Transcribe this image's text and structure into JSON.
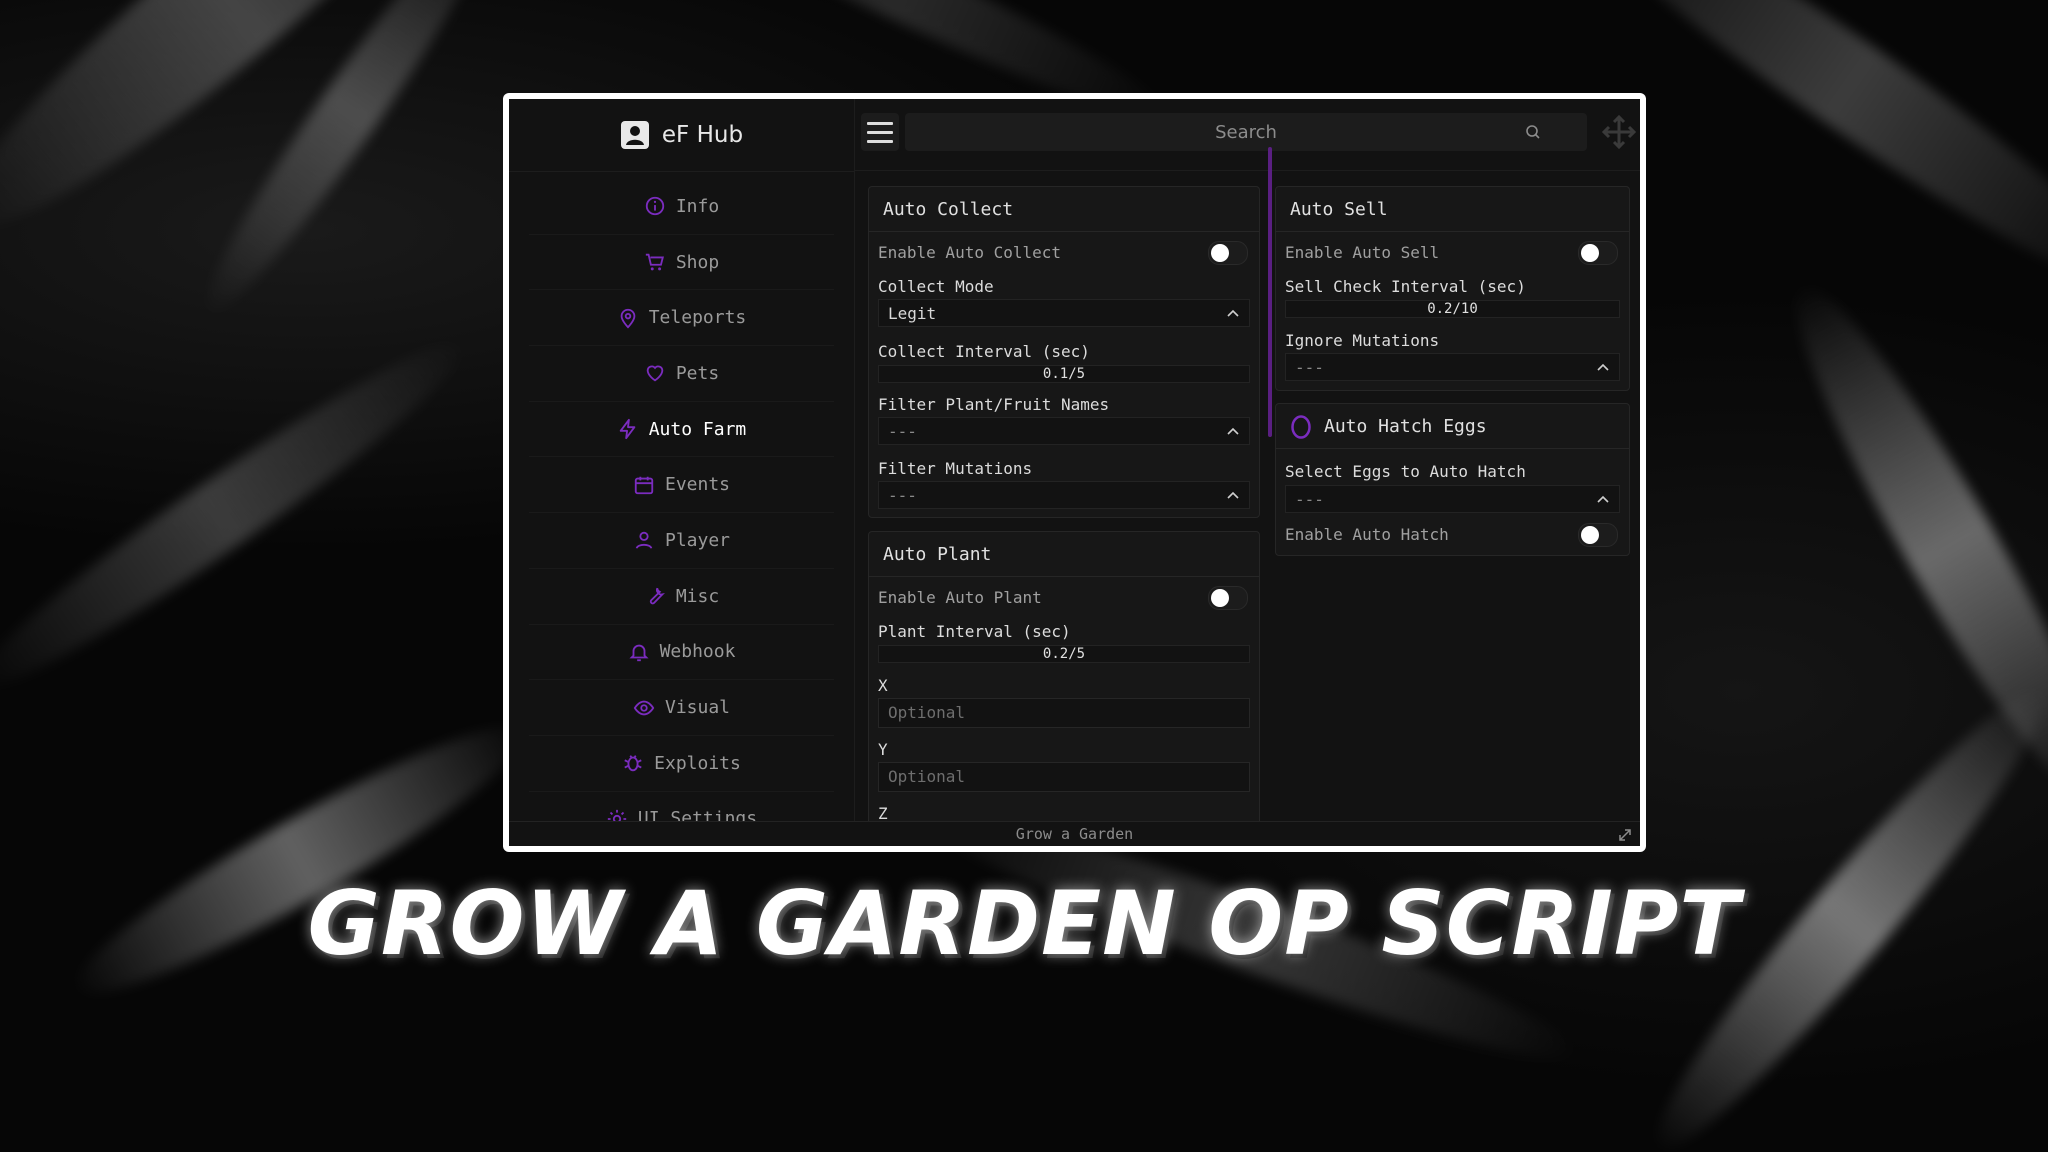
{
  "app": {
    "title": "eF Hub",
    "footer": "Grow a Garden"
  },
  "accent_color": "#7b2cbf",
  "search": {
    "placeholder": "Search"
  },
  "sidebar": {
    "items": [
      {
        "label": "Info",
        "icon": "info-icon",
        "active": false
      },
      {
        "label": "Shop",
        "icon": "cart-icon",
        "active": false
      },
      {
        "label": "Teleports",
        "icon": "map-pin-icon",
        "active": false
      },
      {
        "label": "Pets",
        "icon": "heart-icon",
        "active": false
      },
      {
        "label": "Auto Farm",
        "icon": "lightning-icon",
        "active": true
      },
      {
        "label": "Events",
        "icon": "calendar-icon",
        "active": false
      },
      {
        "label": "Player",
        "icon": "user-icon",
        "active": false
      },
      {
        "label": "Misc",
        "icon": "wrench-icon",
        "active": false
      },
      {
        "label": "Webhook",
        "icon": "bell-icon",
        "active": false
      },
      {
        "label": "Visual",
        "icon": "eye-icon",
        "active": false
      },
      {
        "label": "Exploits",
        "icon": "bug-icon",
        "active": false
      },
      {
        "label": "UI Settings",
        "icon": "gear-icon",
        "active": false
      }
    ]
  },
  "auto_collect": {
    "title": "Auto Collect",
    "enable_label": "Enable Auto Collect",
    "enabled": false,
    "mode_label": "Collect Mode",
    "mode_value": "Legit",
    "interval_label": "Collect Interval (sec)",
    "interval_value": "0.1/5",
    "filter_names_label": "Filter Plant/Fruit Names",
    "filter_names_value": "---",
    "filter_mutations_label": "Filter Mutations",
    "filter_mutations_value": "---"
  },
  "auto_plant": {
    "title": "Auto Plant",
    "enable_label": "Enable Auto Plant",
    "enabled": false,
    "interval_label": "Plant Interval (sec)",
    "interval_value": "0.2/5",
    "x_label": "X",
    "x_placeholder": "Optional",
    "y_label": "Y",
    "y_placeholder": "Optional",
    "z_label": "Z"
  },
  "auto_sell": {
    "title": "Auto Sell",
    "enable_label": "Enable Auto Sell",
    "enabled": false,
    "interval_label": "Sell Check Interval (sec)",
    "interval_value": "0.2/10",
    "ignore_label": "Ignore Mutations",
    "ignore_value": "---"
  },
  "auto_hatch": {
    "title": "Auto Hatch Eggs",
    "select_label": "Select Eggs to Auto Hatch",
    "select_value": "---",
    "enable_label": "Enable Auto Hatch",
    "enabled": false
  },
  "headline": "GROW A GARDEN OP SCRIPT"
}
